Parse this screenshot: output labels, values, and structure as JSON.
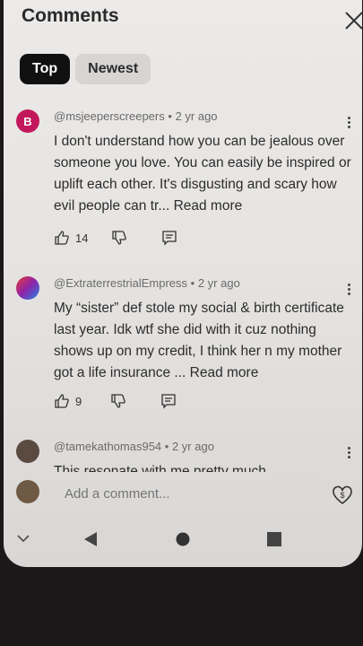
{
  "header": {
    "title": "Comments"
  },
  "tabs": [
    {
      "label": "Top"
    },
    {
      "label": "Newest"
    }
  ],
  "comments": [
    {
      "avatar_letter": "B",
      "avatar_color": "#c2185b",
      "handle": "@msjeeperscreepers",
      "age": "2 yr ago",
      "text": "I don't understand how you can be jealous over someone you love. You can easily be inspired or uplift each other. It's disgusting and scary how evil people can tr...",
      "more": "Read more",
      "likes": "14"
    },
    {
      "avatar_letter": "",
      "avatar_color": "#7a4a8e",
      "handle": "@ExtraterrestrialEmpress",
      "age": "2 yr ago",
      "text": "My “sister” def stole my social & birth certificate last year. Idk wtf she did with it cuz nothing shows up on my credit, I think her n my mother got a life insurance ...",
      "more": "Read more",
      "likes": "9"
    },
    {
      "avatar_letter": "",
      "avatar_color": "#5a4a40",
      "handle": "@tamekathomas954",
      "age": "2 yr ago",
      "text": "This resonate with me pretty much",
      "more": "",
      "likes": ""
    }
  ],
  "composer": {
    "placeholder": "Add a comment..."
  },
  "separator": "•",
  "icons": {
    "close": "close-icon",
    "like": "thumbs-up-icon",
    "dislike": "thumbs-down-icon",
    "reply": "reply-icon",
    "menu": "more-vert-icon",
    "thanks": "super-thanks-icon",
    "nav_back": "back-icon",
    "nav_home": "home-icon",
    "nav_recents": "recents-icon",
    "nav_collapse": "chevron-down-icon"
  }
}
